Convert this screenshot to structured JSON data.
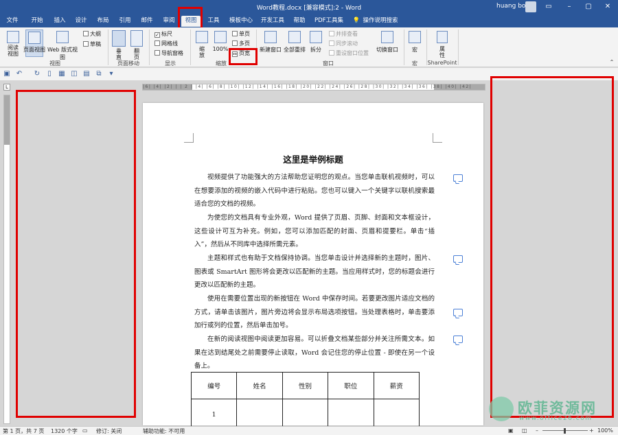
{
  "window": {
    "title": "Word教程.docx [兼容模式]:2 - Word",
    "user": "huang bo"
  },
  "tabs": [
    "文件",
    "开始",
    "插入",
    "设计",
    "布局",
    "引用",
    "邮件",
    "审阅",
    "视图",
    "工具",
    "模板中心",
    "开发工具",
    "帮助",
    "PDF工具集",
    "操作说明搜索"
  ],
  "active_tab": "视图",
  "ribbon": {
    "views": {
      "read": "阅读\n视图",
      "print": "页面视图",
      "web": "Web 版式视图",
      "outline": "大纲",
      "draft": "草稿",
      "group": "视图"
    },
    "page_move": {
      "vertical": "垂\n直",
      "side": "翻\n页",
      "group": "页面移动"
    },
    "show": {
      "ruler": "标尺",
      "gridlines": "网格线",
      "nav": "导航窗格",
      "group": "显示"
    },
    "zoom": {
      "zoom": "缩\n放",
      "pct": "100%",
      "one_page": "单页",
      "multi_page": "多页",
      "page_width": "页宽",
      "group": "缩放"
    },
    "window": {
      "new": "新建窗口",
      "arrange": "全部重排",
      "split": "拆分",
      "side_by_side": "并排查看",
      "sync_scroll": "同步滚动",
      "reset_pos": "重设窗口位置",
      "switch": "切换窗口",
      "group": "窗口"
    },
    "macros": {
      "label": "宏",
      "group": "宏"
    },
    "sharepoint": {
      "label": "属\n性",
      "group": "SharePoint"
    }
  },
  "ruler": {
    "h_numbers": "|6| |4| |2| |  | 2 | |4| |6| |8| |10| |12| |14| |16| |18| |20| |22| |24| |26| |28| |30| |32| |34| |36| |38| |40| |42|"
  },
  "document": {
    "title": "这里是举例标题",
    "paragraphs": [
      "视频提供了功能强大的方法帮助您证明您的观点。当您单击联机视频时，可以在想要添加的视频的嵌入代码中进行粘贴。您也可以键入一个关键字以联机搜索最适合您的文档的视频。",
      "为使您的文档具有专业外观，Word 提供了页眉、页脚、封面和文本框设计，这些设计可互为补充。例如，您可以添加匹配的封面、页眉和提要栏。单击“插入”，然后从不同库中选择所需元素。",
      "主题和样式也有助于文档保持协调。当您单击设计并选择新的主题时，图片、图表或 SmartArt 图形将会更改以匹配新的主题。当应用样式时，您的标题会进行更改以匹配新的主题。",
      "使用在需要位置出现的新按钮在 Word 中保存时间。若要更改图片适应文档的方式，请单击该图片，图片旁边将会显示布局选项按钮。当处理表格时，单击要添加行或列的位置，然后单击加号。",
      "在新的阅读视图中阅读更加容易。可以折叠文档某些部分并关注所需文本。如果在达到结尾处之前需要停止读取，Word 会记住您的停止位置 - 即使在另一个设备上。"
    ],
    "table": {
      "headers": [
        "编号",
        "姓名",
        "性别",
        "职位",
        "薪资"
      ],
      "rows": [
        [
          "1",
          "",
          "",
          "",
          ""
        ]
      ]
    }
  },
  "status": {
    "page": "第 1 页，共 7 页",
    "words": "1320 个字",
    "track": "修订: 关闭",
    "access": "辅助功能: 不可用",
    "zoom": "100%"
  },
  "watermark": {
    "name": "欧菲资源网",
    "url": "www.office26.com"
  },
  "colors": {
    "title_bar": "#2b579a",
    "highlight": "#e00000",
    "comment": "#4a7fd6"
  }
}
